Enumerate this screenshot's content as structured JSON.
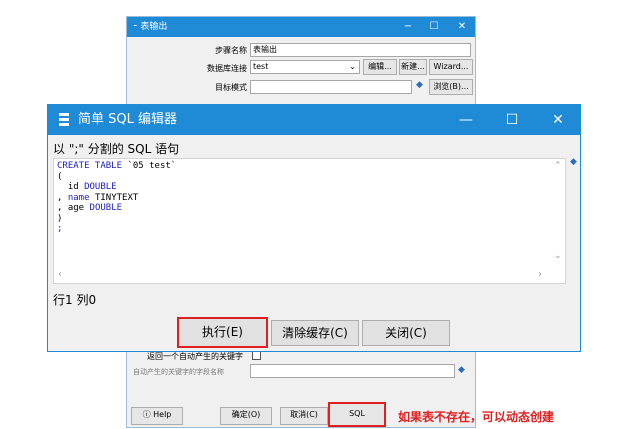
{
  "back_window": {
    "title": "表输出",
    "controls": {
      "minimize": "−",
      "maximize": "☐",
      "close": "✕"
    },
    "fields": {
      "step_name_label": "步骤名称",
      "step_name_value": "表输出",
      "db_conn_label": "数据库连接",
      "db_conn_value": "test",
      "edit_btn": "编辑...",
      "new_btn": "新建...",
      "wizard_btn": "Wizard...",
      "target_schema_label": "目标模式",
      "browse_btn": "浏览(B)...",
      "return_key_label": "返回一个自动产生的关键字",
      "key_field_label": "自动产生的关键字的字段名称"
    },
    "footer": {
      "help": "Help",
      "ok": "确定(O)",
      "cancel": "取消(C)",
      "sql": "SQL"
    }
  },
  "front_window": {
    "title": "简单 SQL 编辑器",
    "controls": {
      "minimize": "—",
      "maximize": "☐",
      "close": "✕"
    },
    "heading": "以 \";\" 分割的 SQL 语句",
    "code": {
      "line1_kw": "CREATE TABLE",
      "line1_rest": " `05 test`",
      "line2": "(",
      "line3_name": "  id ",
      "line3_type": "DOUBLE",
      "line4_prefix": ", ",
      "line4_name": "name",
      "line4_type": " TINYTEXT",
      "line5_prefix": ", ",
      "line5_name": "age ",
      "line5_type": "DOUBLE",
      "line6": ")",
      "line7": ";"
    },
    "status": "行1 列0",
    "buttons": {
      "execute": "执行(E)",
      "clear_cache": "清除缓存(C)",
      "close": "关闭(C)"
    }
  },
  "annotation": "如果表不存在，可以动态创建",
  "colors": {
    "accent": "#1f8ad6",
    "highlight": "#e02020"
  }
}
